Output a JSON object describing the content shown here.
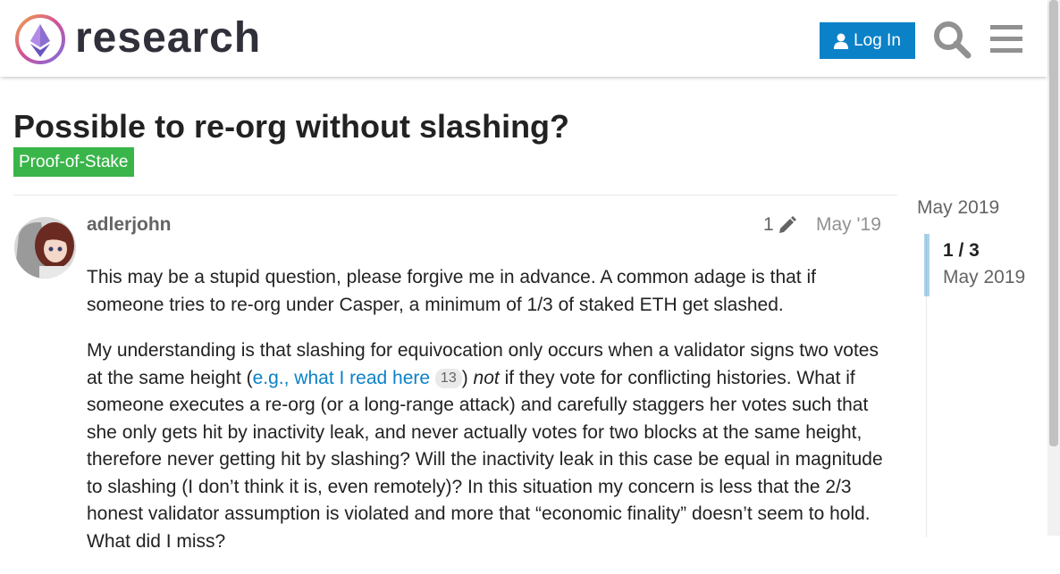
{
  "header": {
    "brand": "research",
    "login_label": "Log In",
    "icons": [
      "search-icon",
      "hamburger-menu-icon",
      "user-icon"
    ]
  },
  "topic": {
    "title": "Possible to re-org without slashing?",
    "category": "Proof-of-Stake",
    "category_color": "#3ab54a"
  },
  "post": {
    "username": "adlerjohn",
    "edit_count": "1",
    "date": "May '19",
    "p1": "This may be a stupid question, please forgive me in advance. A common adage is that if someone tries to re-org under Casper, a minimum of 1/3 of staked ETH get slashed.",
    "p2_before": "My understanding is that slashing for equivocation only occurs when a validator signs two votes at the same height (",
    "p2_link": "e.g., what I read here",
    "p2_link_clicks": "13",
    "p2_mid": ") ",
    "p2_em": "not",
    "p2_after": " if they vote for conflicting histories. What if someone executes a re-org (or a long-range attack) and carefully staggers her votes such that she only gets hit by inactivity leak, and never actually votes for two blocks at the same height, therefore never getting hit by slashing? Will the inactivity leak in this case be equal in magnitude to slashing (I don’t think it is, even remotely)? In this situation my concern is less that the 2/3 honest validator assumption is violated and more that “economic finality” doesn’t seem to hold. What did I miss?"
  },
  "timeline": {
    "top_date": "May 2019",
    "position": "1 / 3",
    "current_date": "May 2019"
  },
  "colors": {
    "accent": "#0b81c7",
    "text": "#222222",
    "muted": "#646464"
  }
}
